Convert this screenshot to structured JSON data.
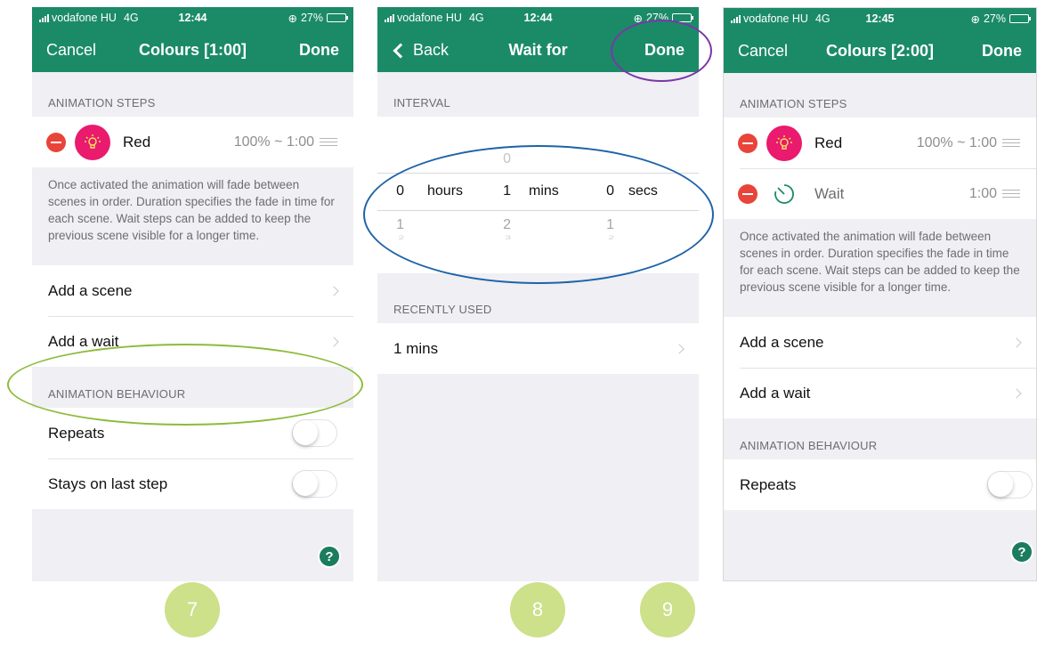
{
  "colors": {
    "brand_green": "#1b8a67",
    "annotation_green": "#8dbb3a",
    "annotation_blue": "#1e63a8",
    "annotation_purple": "#7a37a8",
    "badge": "#cde08a"
  },
  "status": {
    "carrier": "vodafone HU",
    "network": "4G",
    "battery": "27%",
    "time_1": "12:44",
    "time_2": "12:44",
    "time_3": "12:45"
  },
  "screen1": {
    "cancel": "Cancel",
    "title": "Colours [1:00]",
    "done": "Done",
    "section_steps": "ANIMATION STEPS",
    "step_name": "Red",
    "step_value": "100% ~ 1:00",
    "note": "Once activated the animation will fade between scenes in order. Duration specifies the fade in time for each scene. Wait steps can be added to keep the previous scene visible for a longer time.",
    "add_scene": "Add a scene",
    "add_wait": "Add a wait",
    "section_behaviour": "ANIMATION BEHAVIOUR",
    "repeats": "Repeats",
    "stays_last": "Stays on last step",
    "help": "?"
  },
  "screen2": {
    "back": "Back",
    "title": "Wait for",
    "done": "Done",
    "section_interval": "INTERVAL",
    "picker": {
      "mins_above": "0",
      "hours_value": "0",
      "hours_label": "hours",
      "mins_value": "1",
      "mins_label": "mins",
      "secs_value": "0",
      "secs_label": "secs",
      "hours_below1": "1",
      "mins_below1": "2",
      "secs_below1": "1",
      "hours_below2": "2",
      "mins_below2": "3",
      "secs_below2": "2"
    },
    "section_recent": "RECENTLY USED",
    "recent_item": "1 mins"
  },
  "screen3": {
    "cancel": "Cancel",
    "title": "Colours [2:00]",
    "done": "Done",
    "section_steps": "ANIMATION STEPS",
    "step1_name": "Red",
    "step1_value": "100% ~ 1:00",
    "step2_name": "Wait",
    "step2_value": "1:00",
    "note": "Once activated the animation will fade between scenes in order. Duration specifies the fade in time for each scene. Wait steps can be added to keep the previous scene visible for a longer time.",
    "add_scene": "Add a scene",
    "add_wait": "Add a wait",
    "section_behaviour": "ANIMATION BEHAVIOUR",
    "repeats": "Repeats",
    "help": "?"
  },
  "badges": [
    "7",
    "8",
    "9"
  ]
}
